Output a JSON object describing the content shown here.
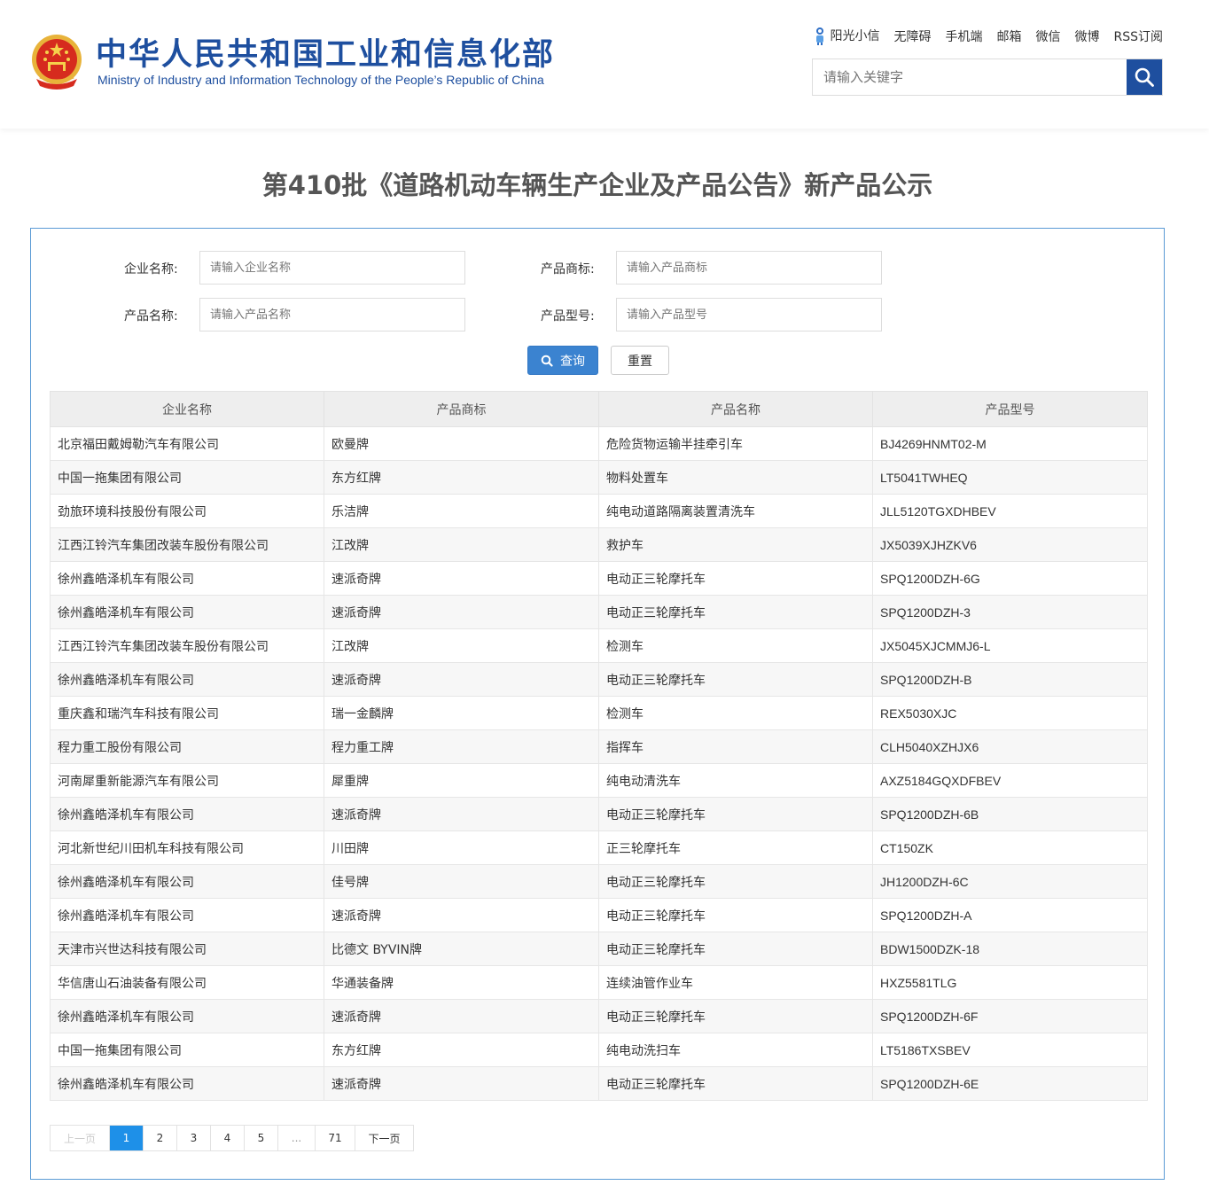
{
  "header": {
    "title": "中华人民共和国工业和信息化部",
    "subtitle": "Ministry of Industry and Information Technology of the People’s Republic of China",
    "links": [
      "阳光小信",
      "无障碍",
      "手机端",
      "邮箱",
      "微信",
      "微博",
      "RSS订阅"
    ],
    "search_placeholder": "请输入关键字"
  },
  "page_title": "第410批《道路机动车辆生产企业及产品公告》新产品公示",
  "form": {
    "company_label": "企业名称:",
    "company_placeholder": "请输入企业名称",
    "brand_label": "产品商标:",
    "brand_placeholder": "请输入产品商标",
    "product_label": "产品名称:",
    "product_placeholder": "请输入产品名称",
    "model_label": "产品型号:",
    "model_placeholder": "请输入产品型号",
    "query_label": "查询",
    "reset_label": "重置"
  },
  "table": {
    "headers": [
      "企业名称",
      "产品商标",
      "产品名称",
      "产品型号"
    ],
    "rows": [
      [
        "北京福田戴姆勒汽车有限公司",
        "欧曼牌",
        "危险货物运输半挂牵引车",
        "BJ4269HNMT02-M"
      ],
      [
        "中国一拖集团有限公司",
        "东方红牌",
        "物料处置车",
        "LT5041TWHEQ"
      ],
      [
        "劲旅环境科技股份有限公司",
        "乐洁牌",
        "纯电动道路隔离装置清洗车",
        "JLL5120TGXDHBEV"
      ],
      [
        "江西江铃汽车集团改装车股份有限公司",
        "江改牌",
        "救护车",
        "JX5039XJHZKV6"
      ],
      [
        "徐州鑫皓泽机车有限公司",
        "速派奇牌",
        "电动正三轮摩托车",
        "SPQ1200DZH-6G"
      ],
      [
        "徐州鑫皓泽机车有限公司",
        "速派奇牌",
        "电动正三轮摩托车",
        "SPQ1200DZH-3"
      ],
      [
        "江西江铃汽车集团改装车股份有限公司",
        "江改牌",
        "检测车",
        "JX5045XJCMMJ6-L"
      ],
      [
        "徐州鑫皓泽机车有限公司",
        "速派奇牌",
        "电动正三轮摩托车",
        "SPQ1200DZH-B"
      ],
      [
        "重庆鑫和瑞汽车科技有限公司",
        "瑞一金麟牌",
        "检测车",
        "REX5030XJC"
      ],
      [
        "程力重工股份有限公司",
        "程力重工牌",
        "指挥车",
        "CLH5040XZHJX6"
      ],
      [
        "河南犀重新能源汽车有限公司",
        "犀重牌",
        "纯电动清洗车",
        "AXZ5184GQXDFBEV"
      ],
      [
        "徐州鑫皓泽机车有限公司",
        "速派奇牌",
        "电动正三轮摩托车",
        "SPQ1200DZH-6B"
      ],
      [
        "河北新世纪川田机车科技有限公司",
        "川田牌",
        "正三轮摩托车",
        "CT150ZK"
      ],
      [
        "徐州鑫皓泽机车有限公司",
        "佳号牌",
        "电动正三轮摩托车",
        "JH1200DZH-6C"
      ],
      [
        "徐州鑫皓泽机车有限公司",
        "速派奇牌",
        "电动正三轮摩托车",
        "SPQ1200DZH-A"
      ],
      [
        "天津市兴世达科技有限公司",
        "比德文 BYVIN牌",
        "电动正三轮摩托车",
        "BDW1500DZK-18"
      ],
      [
        "华信唐山石油装备有限公司",
        "华通装备牌",
        "连续油管作业车",
        "HXZ5581TLG"
      ],
      [
        "徐州鑫皓泽机车有限公司",
        "速派奇牌",
        "电动正三轮摩托车",
        "SPQ1200DZH-6F"
      ],
      [
        "中国一拖集团有限公司",
        "东方红牌",
        "纯电动洗扫车",
        "LT5186TXSBEV"
      ],
      [
        "徐州鑫皓泽机车有限公司",
        "速派奇牌",
        "电动正三轮摩托车",
        "SPQ1200DZH-6E"
      ]
    ]
  },
  "pagination": {
    "prev": "上一页",
    "pages": [
      "1",
      "2",
      "3",
      "4",
      "5",
      "...",
      "71"
    ],
    "current": "1",
    "next": "下一页"
  },
  "colors": {
    "brand_blue": "#1e4f9f",
    "button_blue": "#3b83d0",
    "active_page": "#1e90e8",
    "panel_border": "#5b9bd5"
  },
  "icons": [
    "national-emblem-icon",
    "robot-icon",
    "search-icon",
    "magnifier-icon"
  ]
}
